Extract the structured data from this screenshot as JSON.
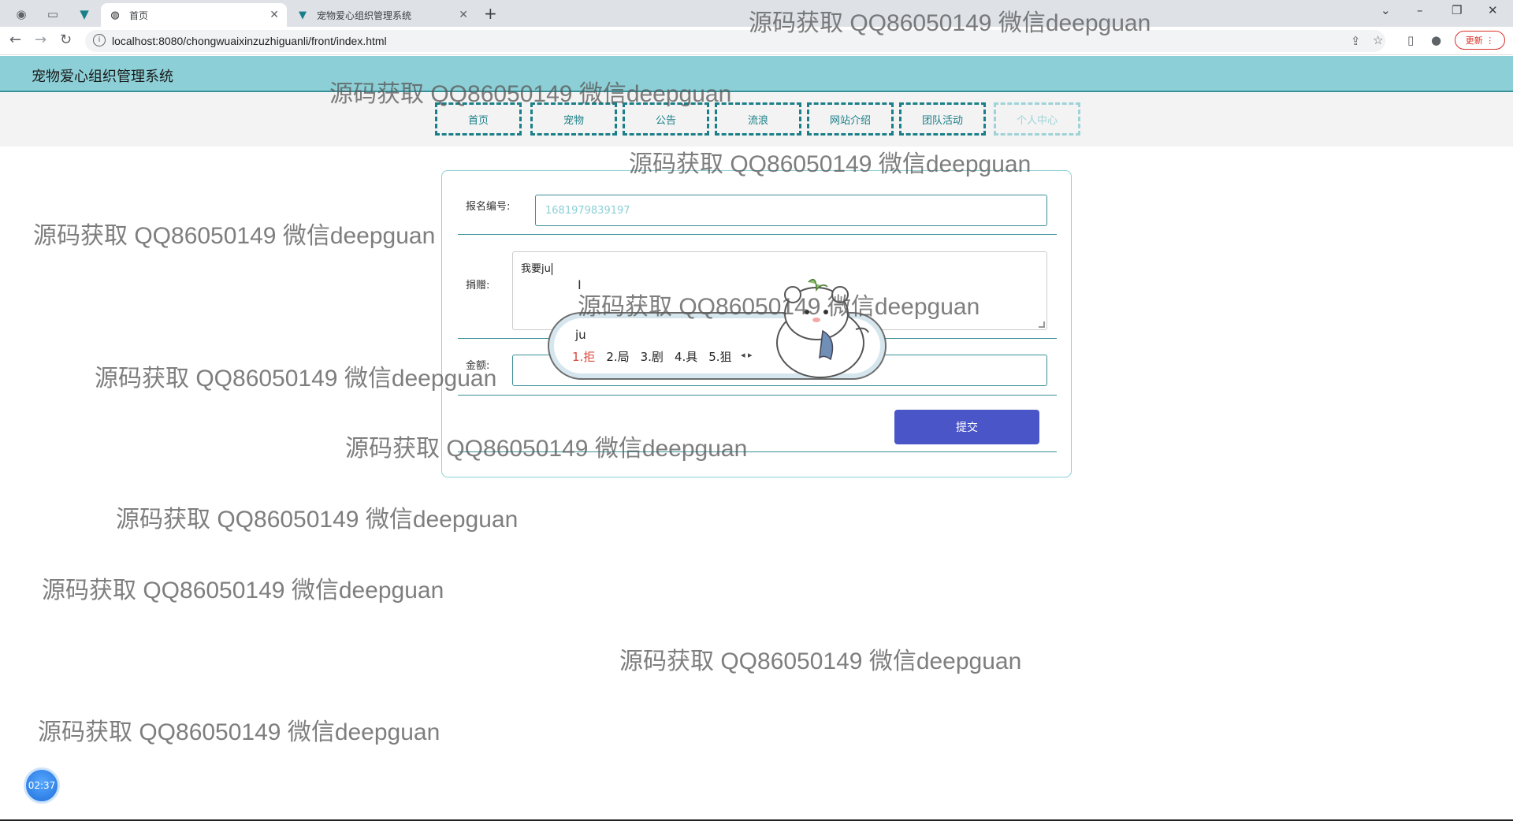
{
  "browser": {
    "tabs": [
      {
        "title": "首页",
        "active": true
      },
      {
        "title": "宠物爱心组织管理系统",
        "active": false
      }
    ],
    "url": "localhost:8080/chongwuaixinzuzhiguanli/front/index.html",
    "update_label": "更新"
  },
  "site": {
    "title": "宠物爱心组织管理系统",
    "nav": [
      "首页",
      "宠物",
      "公告",
      "流浪",
      "网站介绍",
      "团队活动",
      "个人中心"
    ]
  },
  "form": {
    "registration_label": "报名编号:",
    "registration_value": "1681979839197",
    "donate_label": "捐赠:",
    "donate_value": "我要ju",
    "amount_label": "金额:",
    "submit_label": "提交"
  },
  "ime": {
    "typed": "ju",
    "candidates": [
      "1.拒",
      "2.局",
      "3.剧",
      "4.具",
      "5.狙"
    ]
  },
  "timer": "02:37",
  "watermark": "源码获取 QQ86050149 微信deepguan",
  "colors": {
    "header_bg": "#8ccfd6",
    "accent_teal": "#1a7f88",
    "submit_bg": "#4a55c8"
  },
  "icons": [
    "back-icon",
    "forward-icon",
    "reload-icon",
    "info-icon",
    "share-icon",
    "star-icon",
    "sidepanel-icon",
    "profile-icon",
    "menu-icon"
  ]
}
